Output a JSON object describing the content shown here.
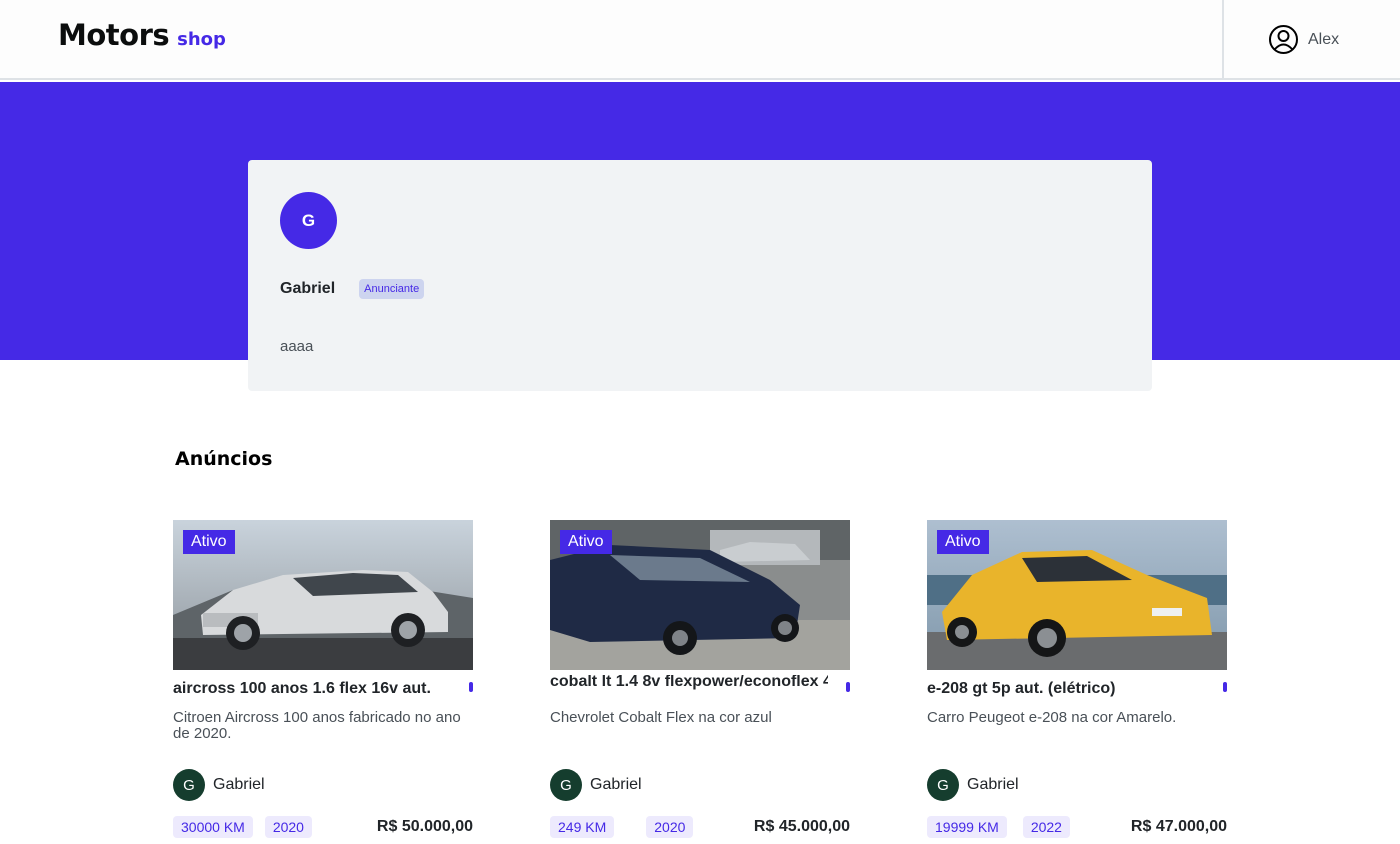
{
  "header": {
    "logo_main": "Motors",
    "logo_sub": "shop",
    "user_name": "Alex"
  },
  "profile": {
    "initial": "G",
    "name": "Gabriel",
    "role": "Anunciante",
    "description": "aaaa"
  },
  "section_title": "Anúncios",
  "colors": {
    "brand": "#4529e6",
    "seller_avatar": "#153d2e",
    "tag_bg": "#edeafd"
  },
  "listings": [
    {
      "status": "Ativo",
      "title": "aircross 100 anos 1.6 flex 16v aut.",
      "description": "Citroen Aircross 100 anos fabricado no ano de 2020.",
      "seller_initial": "G",
      "seller_name": "Gabriel",
      "km": "30000 KM",
      "year": "2020",
      "price": "R$ 50.000,00",
      "image": "silver-suv"
    },
    {
      "status": "Ativo",
      "title": "cobalt lt 1.4 8v flexpower/econoflex 4",
      "description": "Chevrolet Cobalt Flex na cor azul",
      "seller_initial": "G",
      "seller_name": "Gabriel",
      "km": "249 KM",
      "year": "2020",
      "price": "R$ 45.000,00",
      "image": "blue-sedan"
    },
    {
      "status": "Ativo",
      "title": "e-208 gt 5p aut. (elétrico)",
      "description": "Carro Peugeot e-208 na cor Amarelo.",
      "seller_initial": "G",
      "seller_name": "Gabriel",
      "km": "19999 KM",
      "year": "2022",
      "price": "R$ 47.000,00",
      "image": "yellow-hatchback"
    }
  ]
}
